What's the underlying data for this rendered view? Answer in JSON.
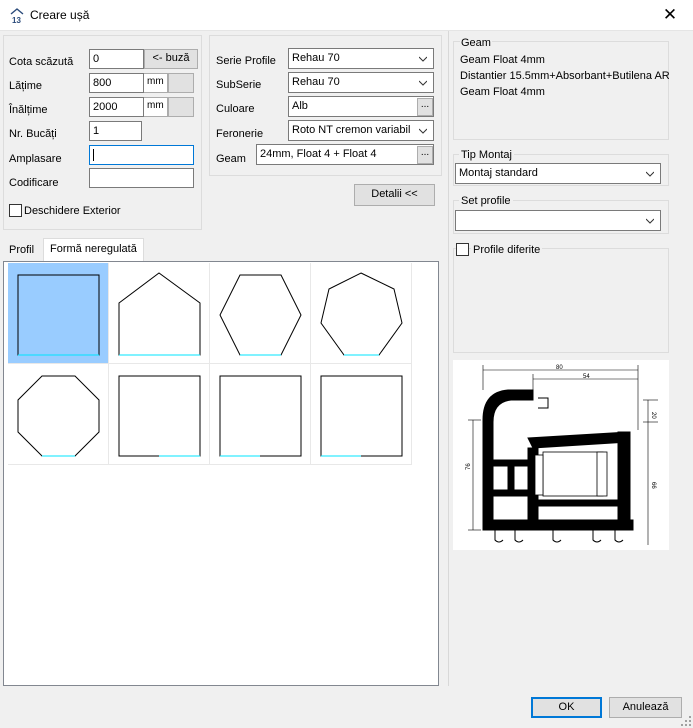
{
  "window": {
    "title": "Creare ușă",
    "app_icon": "door-app-icon",
    "close_glyph": "✕"
  },
  "left_form": {
    "cota_label": "Cota scăzută",
    "cota_value": "0",
    "buza_button": "<- buză",
    "latime_label": "Lățime",
    "latime_value": "800",
    "latime_unit": "mm",
    "inaltime_label": "Înălțime",
    "inaltime_value": "2000",
    "inaltime_unit": "mm",
    "bucati_label": "Nr. Bucăți",
    "bucati_value": "1",
    "amplasare_label": "Amplasare",
    "amplasare_value": "",
    "codificare_label": "Codificare",
    "codificare_value": "",
    "deschidere_label": "Deschidere Exterior"
  },
  "middle_form": {
    "serie_label": "Serie Profile",
    "serie_value": "Rehau 70",
    "subserie_label": "SubSerie",
    "subserie_value": "Rehau 70",
    "culoare_label": "Culoare",
    "culoare_value": "Alb",
    "feronerie_label": "Feronerie",
    "feronerie_value": "Roto NT cremon variabil",
    "geam_label": "Geam",
    "geam_value": "24mm, Float 4 + Float 4",
    "ellipsis": "...",
    "detalii_button": "Detalii <<"
  },
  "tabs": [
    {
      "label": "Profil"
    },
    {
      "label": "Formă neregulată"
    }
  ],
  "shapes": [
    "rectangle",
    "pentagon",
    "hexagon",
    "heptagon",
    "octagon",
    "square",
    "square",
    "square"
  ],
  "right_panel": {
    "geam_title": "Geam",
    "geam_lines": [
      "Geam Float 4mm",
      "Distantier 15.5mm+Absorbant+Butilena AR",
      "Geam Float 4mm"
    ],
    "montaj_title": "Tip Montaj",
    "montaj_value": "Montaj standard",
    "set_profile_title": "Set profile",
    "set_profile_value": "",
    "profile_diferite_label": "Profile diferite",
    "drawing_dims": [
      "80",
      "54",
      "20",
      "76",
      "66"
    ]
  },
  "footer": {
    "ok": "OK",
    "cancel": "Anulează"
  },
  "colors": {
    "selection": "#99ccff",
    "accent": "#0078d7",
    "cyan_line": "#00e5ff"
  }
}
